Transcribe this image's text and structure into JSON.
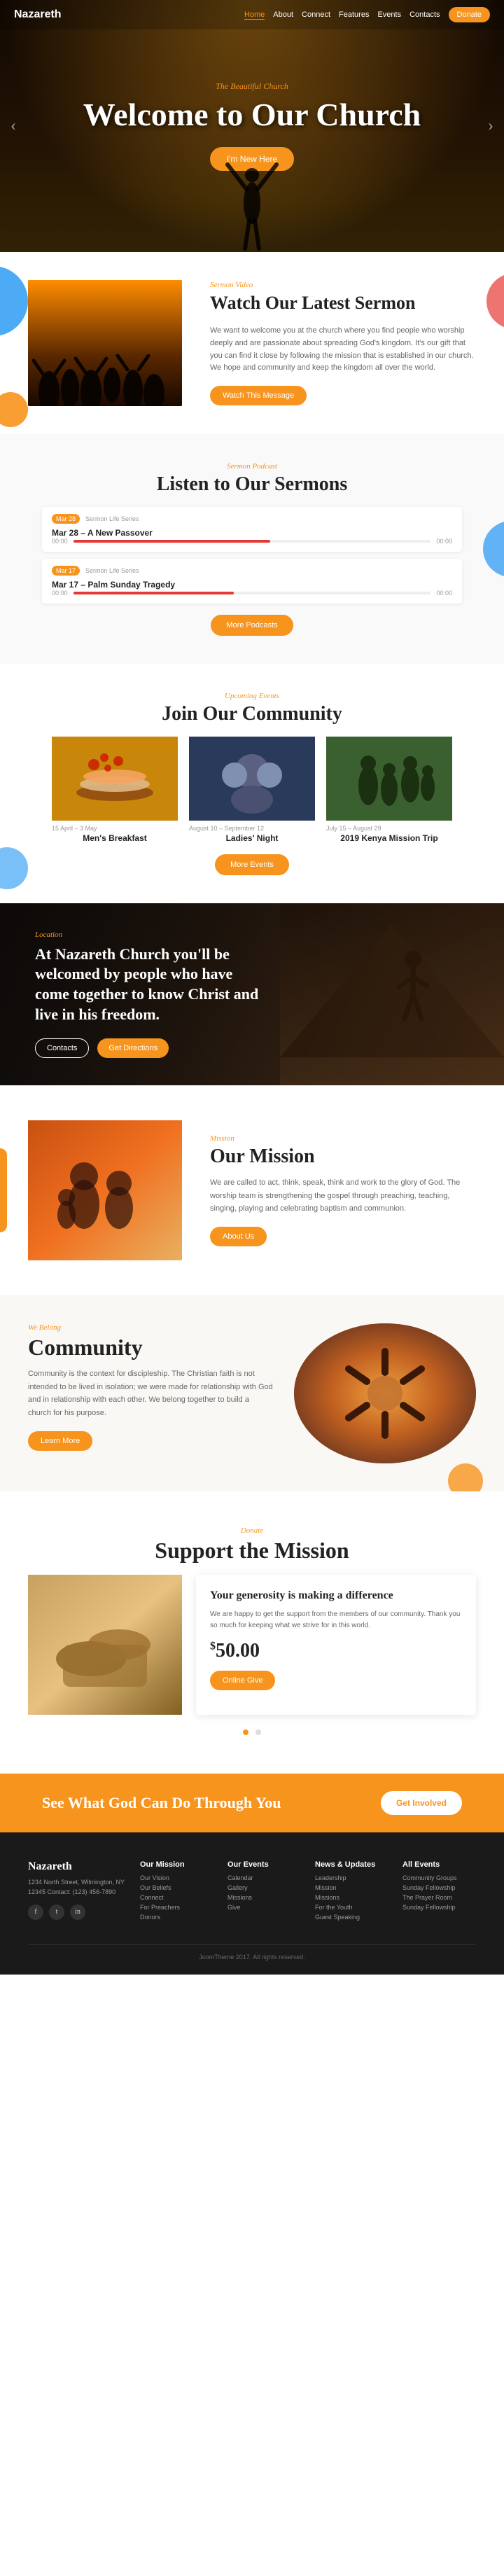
{
  "navbar": {
    "logo": "Nazareth",
    "links": [
      {
        "label": "Home",
        "active": true
      },
      {
        "label": "About"
      },
      {
        "label": "Connect"
      },
      {
        "label": "Features"
      },
      {
        "label": "Events"
      },
      {
        "label": "Contacts"
      }
    ],
    "donate_label": "Donate"
  },
  "hero": {
    "subtitle": "The Beautiful Church",
    "title": "Welcome to Our Church",
    "cta_label": "I'm New Here"
  },
  "watch_sermon": {
    "label": "Sermon Video",
    "title": "Watch Our Latest Sermon",
    "description": "We want to welcome you at the church where you find people who worship deeply and are passionate about spreading God's kingdom. It's our gift that you can find it close by following the mission that is established in our church. We hope and community and keep the kingdom all over the world.",
    "btn_label": "Watch This Message"
  },
  "sermons": {
    "label": "Sermon Podcast",
    "title": "Listen to Our Sermons",
    "items": [
      {
        "date_label": "Mar 28",
        "series": "Sermon Life Series",
        "title": "Mar 28 – A New Passover",
        "time_start": "00:00",
        "time_end": "00:00",
        "progress": 55
      },
      {
        "date_label": "Mar 17",
        "series": "Sermon Life Series",
        "title": "Mar 17 – Palm Sunday Tragedy",
        "time_start": "00:00",
        "time_end": "00:00",
        "progress": 45
      }
    ],
    "more_label": "More Podcasts"
  },
  "community_events": {
    "label": "Upcoming Events",
    "title": "Join Our Community",
    "events": [
      {
        "date": "15 April – 3 May",
        "name": "Men's Breakfast"
      },
      {
        "date": "August 10 – September 12",
        "name": "Ladies' Night"
      },
      {
        "date": "July 15 – August 29",
        "name": "2019 Kenya Mission Trip"
      }
    ],
    "more_label": "More Events"
  },
  "location": {
    "label": "Location",
    "title": "At Nazareth Church you'll be welcomed by people who have come together to know Christ and live in his freedom.",
    "contacts_label": "Contacts",
    "directions_label": "Get Directions"
  },
  "mission": {
    "label": "Mission",
    "title": "Our Mission",
    "description": "We are called to act, think, speak, think and work to the glory of God. The worship team is strengthening the gospel through preaching, teaching, singing, playing and celebrating baptism and communion.",
    "btn_label": "About Us"
  },
  "community_info": {
    "label": "We Belong",
    "title": "Community",
    "description": "Community is the context for discipleship. The Christian faith is not intended to be lived in isolation; we were made for relationship with God and in relationship with each other. We belong together to build a church for his purpose.",
    "btn_label": "Learn More"
  },
  "support": {
    "label": "Donate",
    "title": "Support the Mission",
    "donation": {
      "title": "Your generosity is making a difference",
      "description": "We are happy to get the support from the members of our community. Thank you so much for keeping what we strive for in this world.",
      "amount": "50.00",
      "currency_symbol": "$",
      "btn_label": "Online Give"
    }
  },
  "cta_banner": {
    "text": "See What God Can Do Through You",
    "btn_label": "Get Involved"
  },
  "footer": {
    "logo": "Nazareth",
    "address": "1234 North Street, Wilmington, NY 12345\nContact: (123) 456-7890",
    "social": [
      "f",
      "t",
      "in"
    ],
    "columns": [
      {
        "title": "Our Mission",
        "links": [
          "Our Vision",
          "Our Beliefs",
          "Connect",
          "For Preachers",
          "Donors"
        ]
      },
      {
        "title": "Our Events",
        "links": [
          "Calendar",
          "Gallery",
          "Missions",
          "Give"
        ]
      },
      {
        "title": "News & Updates",
        "links": [
          "Leadership",
          "Mission",
          "Missions",
          "For the Youth",
          "Guest Speaking"
        ]
      },
      {
        "title": "All Events",
        "links": [
          "Community Groups",
          "Sunday Fellowship",
          "The Prayer Room",
          "Sunday Fellowship"
        ]
      }
    ],
    "copyright": "JoomTheme 2017. All rights reserved."
  }
}
